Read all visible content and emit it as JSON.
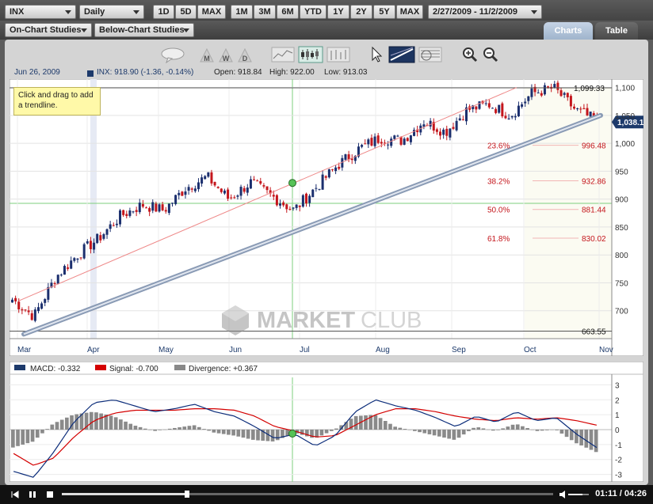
{
  "header": {
    "symbol": "INX",
    "period": "Daily",
    "range_buttons": [
      "1D",
      "5D",
      "MAX",
      "1M",
      "3M",
      "6M",
      "YTD",
      "1Y",
      "2Y",
      "5Y",
      "MAX"
    ],
    "date_range": "2/27/2009 - 11/2/2009",
    "on_chart": "On-Chart Studies",
    "below_chart": "Below-Chart Studies",
    "tabs": {
      "charts": "Charts",
      "table": "Table"
    }
  },
  "info": {
    "date": "Jun 26, 2009",
    "quote": "INX: 918.90 (-1.36, -0.14%)",
    "open": "Open: 918.84",
    "high": "High: 922.00",
    "low": "Low: 913.03"
  },
  "tooltip": "Click and drag to add a trendline.",
  "watermark": {
    "left": "MARKET",
    "right": "CLUB"
  },
  "price": {
    "last_label": "1,038.15",
    "high_label": "1,099.33",
    "low_label": "663.55",
    "fib": [
      {
        "pct": "23.6%",
        "value": "996.48"
      },
      {
        "pct": "38.2%",
        "value": "932.86"
      },
      {
        "pct": "50.0%",
        "value": "881.44"
      },
      {
        "pct": "61.8%",
        "value": "830.02"
      }
    ],
    "yticks": [
      "1,100",
      "1,050",
      "1,000",
      "950",
      "900",
      "850",
      "800",
      "750",
      "700"
    ],
    "months": [
      "Mar",
      "Apr",
      "May",
      "Jun",
      "Jul",
      "Aug",
      "Sep",
      "Oct",
      "Nov"
    ]
  },
  "macd": {
    "macd_label": "MACD: -0.332",
    "signal_label": "Signal: -0.700",
    "div_label": "Divergence: +0.367",
    "yticks": [
      "3",
      "2",
      "1",
      "0",
      "-1",
      "-2",
      "-3"
    ]
  },
  "player": {
    "time": "01:11 / 04:26"
  },
  "colors": {
    "up": "#1b2f6e",
    "down": "#c4161c",
    "signal": "#d40000",
    "macd": "#0c2d7a",
    "fib": "#c4161c",
    "accent": "#1d3a6b"
  },
  "chart_data": [
    {
      "type": "candlestick",
      "title": "INX",
      "ylim": [
        650,
        1115
      ],
      "x": [
        "Mar",
        "Apr",
        "May",
        "Jun",
        "Jul",
        "Aug",
        "Sep",
        "Oct",
        "Nov"
      ],
      "close": [
        720,
        690,
        760,
        800,
        830,
        870,
        890,
        880,
        920,
        940,
        900,
        930,
        905,
        880,
        920,
        960,
        990,
        1010,
        1005,
        1040,
        1020,
        1060,
        1070,
        1050,
        1090,
        1099,
        1060,
        1040
      ],
      "fib_levels": [
        996.48,
        932.86,
        881.44,
        830.02
      ],
      "high_line": 1099.33,
      "low_line": 663.55
    },
    {
      "type": "line",
      "title": "MACD",
      "ylim": [
        -3.5,
        3.5
      ],
      "series": [
        {
          "name": "MACD",
          "values": [
            -2.8,
            -3.2,
            -1.5,
            0.5,
            1.8,
            2.0,
            1.6,
            1.2,
            1.4,
            1.7,
            1.2,
            0.9,
            0.2,
            -0.6,
            -0.3,
            -1.1,
            -0.4,
            1.2,
            2.0,
            1.6,
            1.3,
            0.8,
            0.2,
            0.9,
            0.5,
            1.2,
            0.6,
            0.8,
            -0.3,
            -1.2
          ]
        },
        {
          "name": "Signal",
          "values": [
            -1.6,
            -2.4,
            -1.9,
            -0.5,
            0.6,
            1.1,
            1.3,
            1.3,
            1.3,
            1.4,
            1.4,
            1.3,
            0.9,
            0.2,
            -0.1,
            -0.5,
            -0.4,
            0.3,
            1.0,
            1.4,
            1.4,
            1.2,
            0.9,
            0.7,
            0.6,
            0.8,
            0.7,
            0.8,
            0.6,
            0.3
          ]
        },
        {
          "name": "Divergence",
          "values": [
            -1.2,
            -0.8,
            0.4,
            1.0,
            1.2,
            0.9,
            0.3,
            -0.1,
            0.1,
            0.3,
            -0.2,
            -0.4,
            -0.7,
            -0.8,
            -0.2,
            -0.6,
            0.0,
            0.9,
            1.0,
            0.2,
            -0.1,
            -0.4,
            -0.7,
            0.2,
            -0.1,
            0.4,
            -0.1,
            0.0,
            -0.9,
            -1.5
          ]
        }
      ]
    }
  ]
}
